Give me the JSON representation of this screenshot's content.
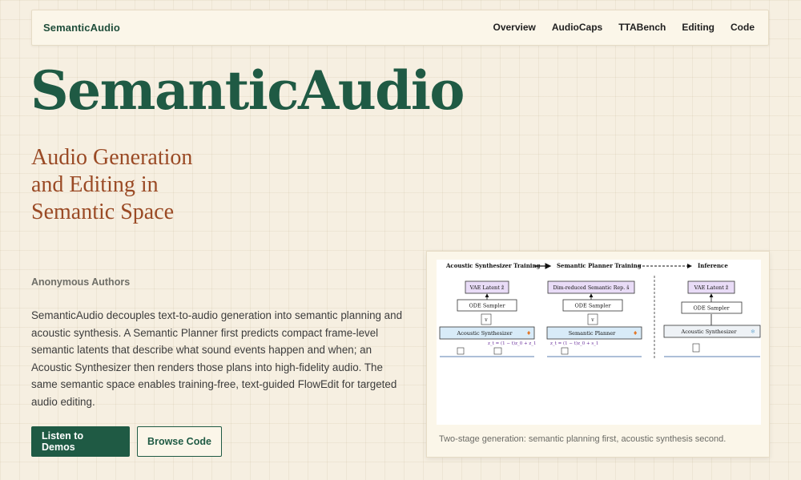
{
  "nav": {
    "brand": "SemanticAudio",
    "links": [
      "Overview",
      "AudioCaps",
      "TTABench",
      "Editing",
      "Code"
    ]
  },
  "hero": {
    "title": "SemanticAudio",
    "subtitle": "Audio Generation and Editing in Semantic Space",
    "authors": "Anonymous Authors",
    "description": "SemanticAudio decouples text-to-audio generation into semantic planning and acoustic synthesis. A Semantic Planner first predicts compact frame-level semantic latents that describe what sound events happen and when; an Acoustic Synthesizer then renders those plans into high-fidelity audio. The same semantic space enables training-free, text-guided FlowEdit for targeted audio editing."
  },
  "buttons": {
    "primary": "Listen to Demos",
    "secondary": "Browse Code"
  },
  "figure": {
    "caption": "Two-stage generation: semantic planning first, acoustic synthesis second.",
    "diagram": {
      "stage1": "Acoustic Synthesizer Training",
      "stage2": "Semantic Planner Training",
      "stage3": "Inference",
      "vae_latent": "VAE Latent ẑ",
      "dim_reduced": "Dim-reduced Semantic Rep. ŝ",
      "ode_sampler": "ODE Sampler",
      "acoustic_synth": "Acoustic Synthesizer",
      "semantic_planner": "Semantic Planner",
      "v_syn": "v",
      "v_plan": "v",
      "eq1": "z_t = (1 − t)z_0 + z_1",
      "eq2": "z_t = (1 − t)z_0 + s_1"
    }
  },
  "colors": {
    "brand_green": "#1f5a44",
    "accent_rust": "#9a4a25",
    "background": "#f6efe1"
  }
}
